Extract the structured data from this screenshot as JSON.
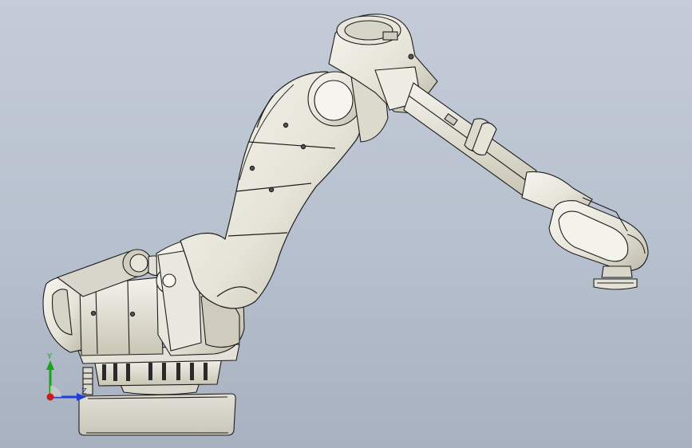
{
  "view": {
    "background_top": "#c4ccd8",
    "background_bottom": "#a7b1c0",
    "model_fill": "#ecebe2",
    "model_shade": "#c7c4b4",
    "edge_color": "#1d1d1d"
  },
  "triad": {
    "y_label": "Y",
    "z_label": "Z",
    "y_color": "#1aa31a",
    "z_color": "#1f3fd6",
    "x_color": "#d01a1a"
  }
}
